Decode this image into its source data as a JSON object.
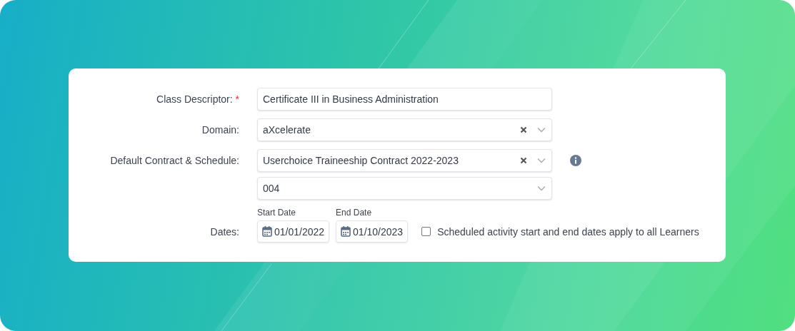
{
  "form": {
    "fields": [
      {
        "kind": "text",
        "label": "Class Descriptor:",
        "required_mark": "*",
        "value": "Certificate III in Business Administration"
      },
      {
        "kind": "select",
        "label": "Domain:",
        "value": "aXcelerate",
        "clearable": true,
        "info": false
      },
      {
        "kind": "select",
        "label": "Default Contract & Schedule:",
        "value": "Userchoice Traineeship Contract 2022-2023",
        "clearable": true,
        "info": true
      },
      {
        "kind": "select",
        "value": "004",
        "clearable": false,
        "info": false
      },
      {
        "kind": "dates",
        "label": "Dates:",
        "start_label": "Start Date",
        "start": "01/01/2022",
        "end_label": "End Date",
        "end": "01/10/2023",
        "apply_all": {
          "label": "Scheduled activity start and end dates apply to all Learners",
          "checked": false
        }
      }
    ]
  }
}
